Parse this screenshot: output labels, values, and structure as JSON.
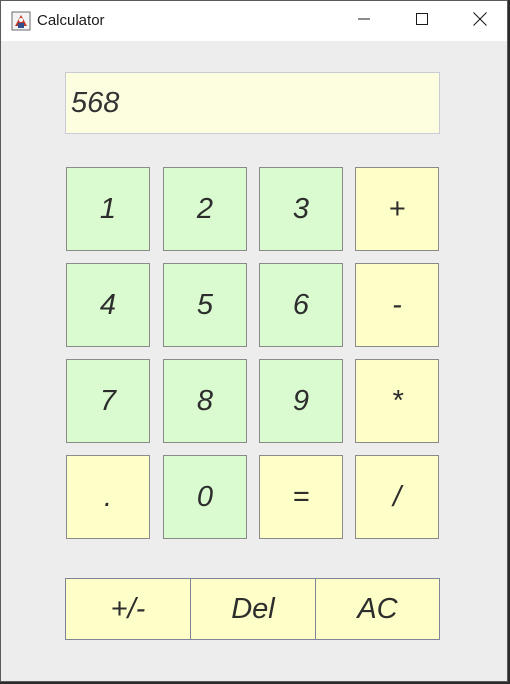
{
  "window": {
    "title": "Calculator",
    "controls": {
      "minimize": "minimize",
      "maximize": "maximize",
      "close": "close"
    }
  },
  "display": {
    "value": "568"
  },
  "keypad": {
    "rows": [
      [
        {
          "label": "1",
          "kind": "number"
        },
        {
          "label": "2",
          "kind": "number"
        },
        {
          "label": "3",
          "kind": "number"
        },
        {
          "label": "+",
          "kind": "operator"
        }
      ],
      [
        {
          "label": "4",
          "kind": "number"
        },
        {
          "label": "5",
          "kind": "number"
        },
        {
          "label": "6",
          "kind": "number"
        },
        {
          "label": "-",
          "kind": "operator"
        }
      ],
      [
        {
          "label": "7",
          "kind": "number"
        },
        {
          "label": "8",
          "kind": "number"
        },
        {
          "label": "9",
          "kind": "number"
        },
        {
          "label": "*",
          "kind": "operator"
        }
      ],
      [
        {
          "label": ".",
          "kind": "operator"
        },
        {
          "label": "0",
          "kind": "number"
        },
        {
          "label": "=",
          "kind": "operator"
        },
        {
          "label": "/",
          "kind": "operator"
        }
      ]
    ]
  },
  "actions": {
    "negate_label": "+/-",
    "delete_label": "Del",
    "clear_label": "AC"
  },
  "colors": {
    "number_key": "#dafad0",
    "operator_key": "#fefec8",
    "display_bg": "#fdfde0",
    "window_bg": "#ededed"
  }
}
